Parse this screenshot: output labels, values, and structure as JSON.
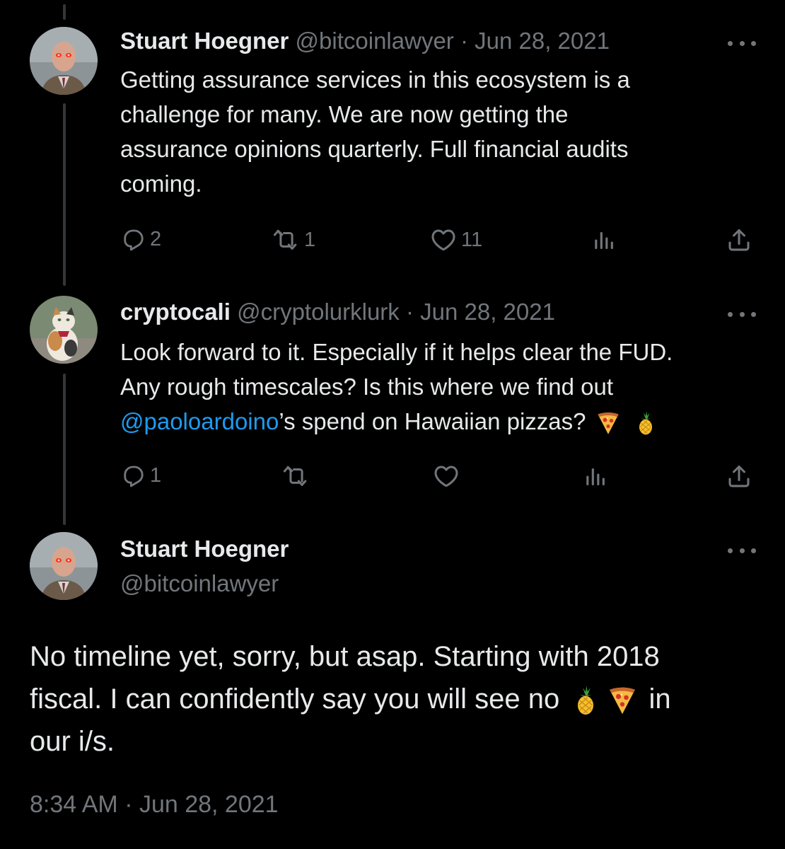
{
  "tweet1": {
    "name": "Stuart Hoegner",
    "handle_date": "@bitcoinlawyer · Jun 28, 2021",
    "text_lines": [
      "Getting assurance services in this ecosystem is a",
      "challenge for many. We are now getting the",
      "assurance opinions quarterly. Full financial audits",
      "coming."
    ],
    "reply_count": "2",
    "retweet_count": "1",
    "like_count": "11"
  },
  "tweet2": {
    "name": "cryptocali",
    "handle_date": "@cryptolurklurk · Jun 28, 2021",
    "line1": "Look forward to it. Especially if it helps clear the FUD.",
    "line2": "Any rough timescales? Is this where we find out",
    "mention": "@paoloardoino",
    "line3_rest": "’s spend on Hawaiian pizzas?",
    "reply_count": "1"
  },
  "main_tweet": {
    "name": "Stuart Hoegner",
    "handle": "@bitcoinlawyer",
    "line1": "No timeline yet, sorry, but asap. Starting with 2018",
    "line2_start": "fiscal. I can confidently say you will see no",
    "line2_end": "in",
    "line3": "our i/s.",
    "timestamp": "8:34 AM · Jun 28, 2021"
  },
  "icons": {
    "reply": "reply-icon",
    "retweet": "retweet-icon",
    "like": "heart-icon",
    "views": "views-icon",
    "share": "share-icon",
    "more": "more-icon",
    "pizza": "pizza-emoji",
    "pineapple": "pineapple-emoji"
  },
  "colors": {
    "background": "#000000",
    "text": "#e7e9ea",
    "secondary": "#71767b",
    "link": "#1d9bf0",
    "thread_line": "#333639"
  }
}
